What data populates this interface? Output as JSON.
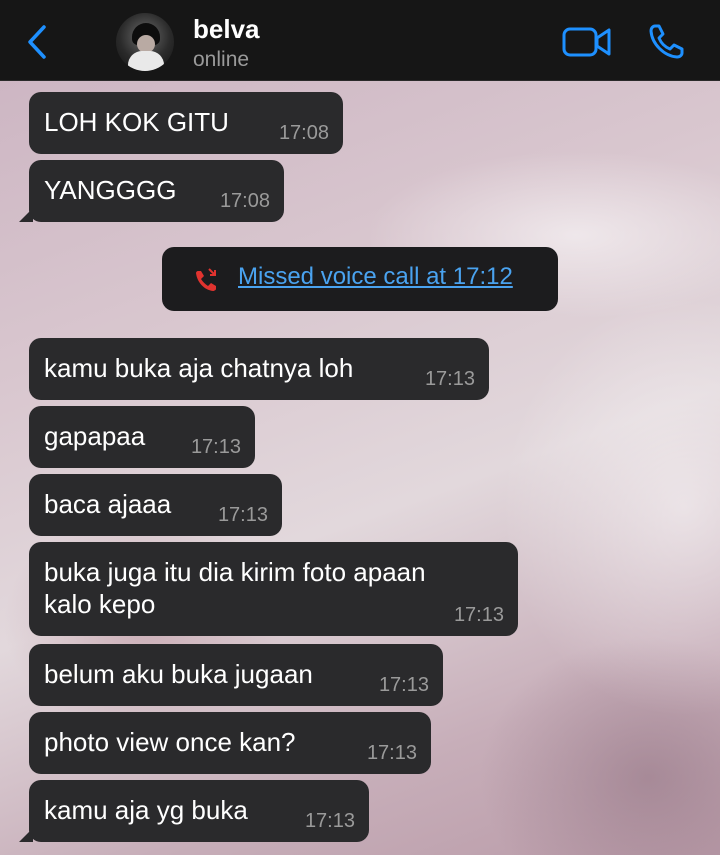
{
  "header": {
    "contact_name": "belva",
    "status": "online",
    "accent_color": "#1e90ff"
  },
  "icons": {
    "back": "chevron-left-icon",
    "video": "video-camera-icon",
    "call": "phone-icon",
    "missed_call": "missed-call-icon"
  },
  "messages": [
    {
      "text": "LOH KOK GITU",
      "time": "17:08"
    },
    {
      "text": "YANGGGG",
      "time": "17:08"
    },
    {
      "text": "kamu buka aja chatnya loh",
      "time": "17:13"
    },
    {
      "text": "gapapaa",
      "time": "17:13"
    },
    {
      "text": "baca ajaaa",
      "time": "17:13"
    },
    {
      "text": "buka juga itu dia kirim foto apaan\nkalo kepo",
      "time": "17:13"
    },
    {
      "text": "belum aku buka jugaan",
      "time": "17:13"
    },
    {
      "text": "photo view once kan?",
      "time": "17:13"
    },
    {
      "text": "kamu aja yg buka",
      "time": "17:13"
    }
  ],
  "system": {
    "missed_call_text": "Missed voice call at 17:12",
    "missed_call_color": "#e0332f"
  }
}
